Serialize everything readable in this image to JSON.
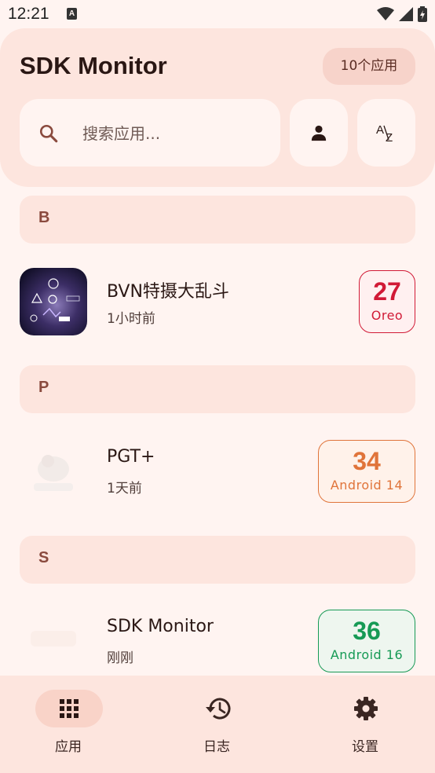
{
  "status_bar": {
    "time": "12:21",
    "notif_icon": "a-letter-icon"
  },
  "header": {
    "title": "SDK Monitor",
    "app_count": "10个应用",
    "search_placeholder": "搜索应用..."
  },
  "sections": [
    {
      "letter": "B",
      "apps": [
        {
          "name": "BVN特摄大乱斗",
          "time": "1小时前",
          "sdk": "27",
          "version": "Oreo",
          "color": "#d11a36"
        }
      ]
    },
    {
      "letter": "P",
      "apps": [
        {
          "name": "PGT+",
          "time": "1天前",
          "sdk": "34",
          "version": "Android 14",
          "color": "#e0743a"
        }
      ]
    },
    {
      "letter": "S",
      "apps": [
        {
          "name": "SDK Monitor",
          "time": "刚刚",
          "sdk": "36",
          "version": "Android 16",
          "color": "#169a55"
        }
      ]
    }
  ],
  "bottom_nav": [
    {
      "label": "应用",
      "icon": "apps-grid-icon",
      "active": true
    },
    {
      "label": "日志",
      "icon": "history-icon",
      "active": false
    },
    {
      "label": "设置",
      "icon": "gear-icon",
      "active": false
    }
  ],
  "colors": {
    "background": "#fff4f1",
    "surface": "#fde5de",
    "accent": "#8a4a3e"
  }
}
